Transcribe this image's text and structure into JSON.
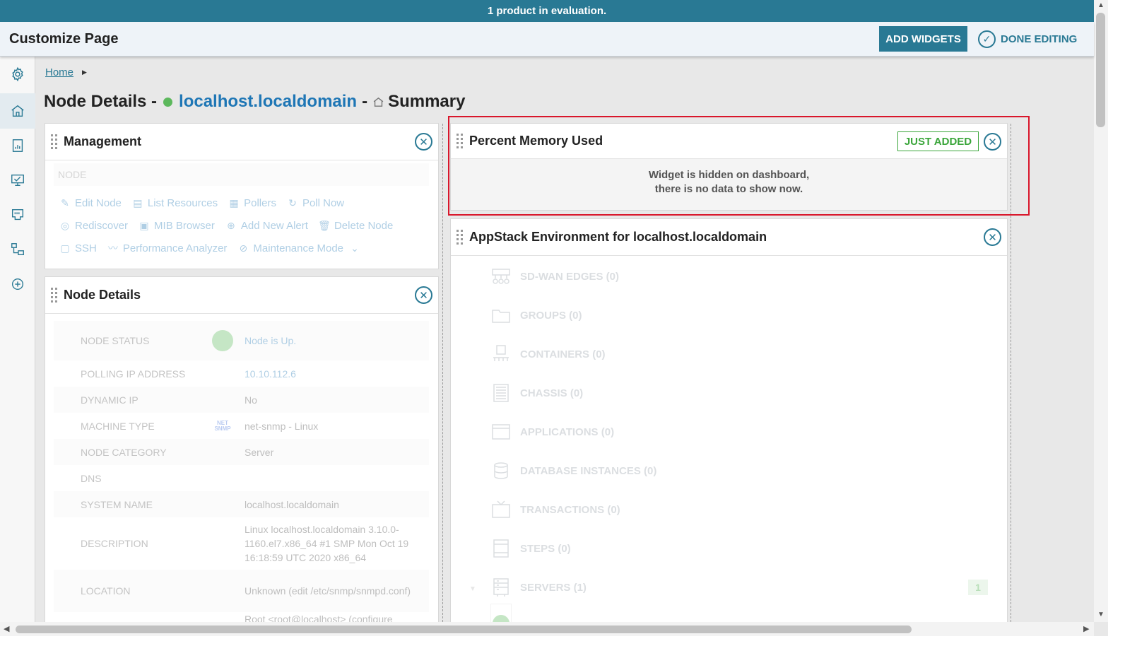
{
  "eval_banner": "1 product in evaluation.",
  "customize_bar": {
    "title": "Customize Page",
    "add_widgets_label": "ADD WIDGETS",
    "done_editing_label": "DONE EDITING"
  },
  "left_rail": {
    "items": [
      {
        "icon": "gear-icon",
        "active": false
      },
      {
        "icon": "home-icon",
        "active": true
      },
      {
        "icon": "report-icon",
        "active": false
      },
      {
        "icon": "monitor-icon",
        "active": false
      },
      {
        "icon": "network-port-icon",
        "active": false
      },
      {
        "icon": "topology-icon",
        "active": false
      },
      {
        "icon": "add-circle-icon",
        "active": false
      }
    ]
  },
  "breadcrumb": {
    "home": "Home"
  },
  "page_title": {
    "prefix": "Node Details -",
    "hostname": "localhost.localdomain",
    "separator": "-",
    "view": "Summary",
    "status_color": "#5cb85c"
  },
  "management": {
    "title": "Management",
    "node_label": "NODE",
    "actions": [
      [
        {
          "label": "Edit Node",
          "icon": "pencil-icon"
        },
        {
          "label": "List Resources",
          "icon": "document-icon"
        },
        {
          "label": "Pollers",
          "icon": "pollers-icon"
        },
        {
          "label": "Poll Now",
          "icon": "refresh-icon"
        }
      ],
      [
        {
          "label": "Rediscover",
          "icon": "rediscover-icon"
        },
        {
          "label": "MIB Browser",
          "icon": "mib-browser-icon"
        },
        {
          "label": "Add New Alert",
          "icon": "add-alert-icon"
        },
        {
          "label": "Delete Node",
          "icon": "trash-icon"
        }
      ],
      [
        {
          "label": "SSH",
          "icon": "ssh-icon"
        },
        {
          "label": "Performance Analyzer",
          "icon": "performance-analyzer-icon"
        },
        {
          "label": "Maintenance Mode",
          "icon": "maintenance-icon"
        }
      ]
    ]
  },
  "node_details": {
    "title": "Node Details",
    "rows": [
      {
        "label": "NODE STATUS",
        "value": "Node is Up.",
        "icon": "status-up-icon",
        "link": true
      },
      {
        "label": "POLLING IP ADDRESS",
        "value": "10.10.112.6",
        "link": true
      },
      {
        "label": "DYNAMIC IP",
        "value": "No"
      },
      {
        "label": "MACHINE TYPE",
        "value": "net-snmp - Linux",
        "icon": "net-snmp-icon",
        "icon_text": "NET\nSNMP"
      },
      {
        "label": "NODE CATEGORY",
        "value": "Server"
      },
      {
        "label": "DNS",
        "value": ""
      },
      {
        "label": "SYSTEM NAME",
        "value": "localhost.localdomain"
      },
      {
        "label": "DESCRIPTION",
        "value": "Linux localhost.localdomain 3.10.0-1160.el7.x86_64 #1 SMP Mon Oct 19 16:18:59 UTC 2020 x86_64"
      },
      {
        "label": "LOCATION",
        "value": "Unknown (edit /etc/snmp/snmpd.conf)"
      },
      {
        "label": "",
        "value": "Root <root@localhost> (configure"
      }
    ]
  },
  "percent_memory": {
    "title": "Percent Memory Used",
    "badge": "JUST ADDED",
    "message_line1": "Widget is hidden on dashboard,",
    "message_line2": "there is no data to show now."
  },
  "appstack": {
    "title": "AppStack Environment for localhost.localdomain",
    "rows": [
      {
        "label": "SD-WAN EDGES (0)",
        "icon": "sdwan-icon"
      },
      {
        "label": "GROUPS (0)",
        "icon": "folder-icon"
      },
      {
        "label": "CONTAINERS (0)",
        "icon": "container-icon"
      },
      {
        "label": "CHASSIS (0)",
        "icon": "chassis-icon"
      },
      {
        "label": "APPLICATIONS (0)",
        "icon": "application-icon"
      },
      {
        "label": "DATABASE INSTANCES (0)",
        "icon": "database-icon"
      },
      {
        "label": "TRANSACTIONS (0)",
        "icon": "transaction-icon"
      },
      {
        "label": "STEPS (0)",
        "icon": "steps-icon"
      },
      {
        "label": "SERVERS (1)",
        "icon": "server-icon"
      }
    ],
    "servers_badge": "1"
  }
}
